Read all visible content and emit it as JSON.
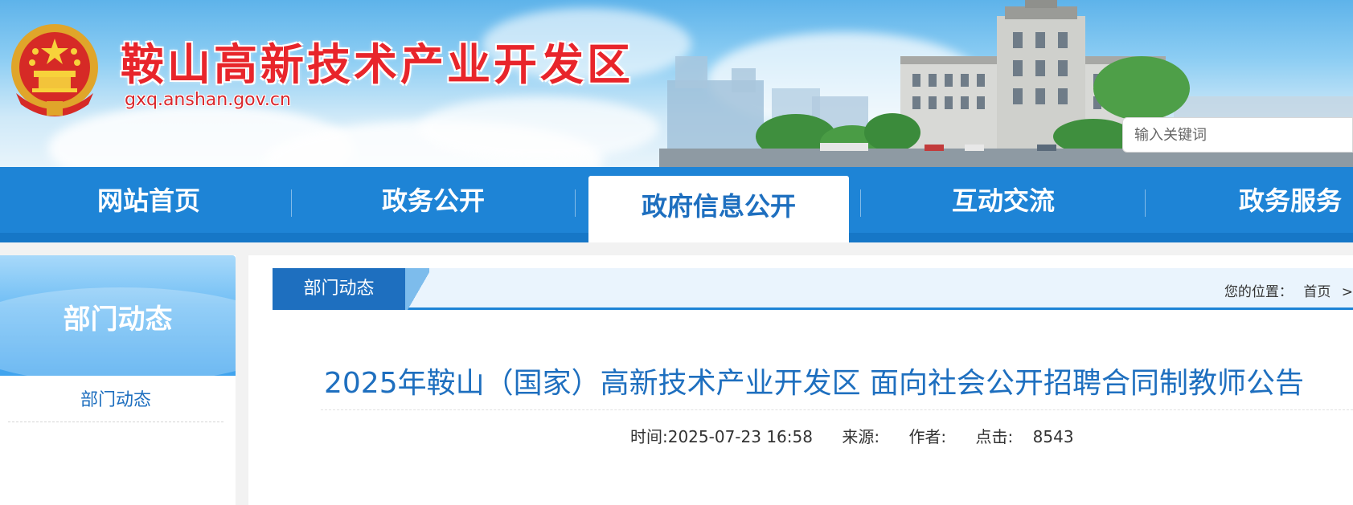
{
  "header": {
    "site_title": "鞍山高新技术产业开发区",
    "site_domain": "gxq.anshan.gov.cn",
    "search_placeholder": "输入关键词"
  },
  "nav": {
    "items": [
      {
        "label": "网站首页"
      },
      {
        "label": "政务公开"
      },
      {
        "label": "政府信息公开"
      },
      {
        "label": "互动交流"
      },
      {
        "label": "政务服务"
      }
    ],
    "active_index": 2
  },
  "sidebar": {
    "title": "部门动态",
    "links": [
      {
        "label": "部门动态"
      }
    ]
  },
  "section": {
    "tab_label": "部门动态",
    "location_prefix": "您的位置：",
    "crumb_home": "首页",
    "crumb_separator": ">"
  },
  "article": {
    "title": "2025年鞍山（国家）高新技术产业开发区 面向社会公开招聘合同制教师公告",
    "time_label": "时间:2025-07-23 16:58",
    "source_label": "来源:",
    "author_label": "作者:",
    "clicks_label": "点击:",
    "clicks_value": "8543"
  },
  "colors": {
    "brand_red": "#e8252b",
    "nav_blue": "#1e84d6",
    "title_blue": "#1e6fbf"
  }
}
